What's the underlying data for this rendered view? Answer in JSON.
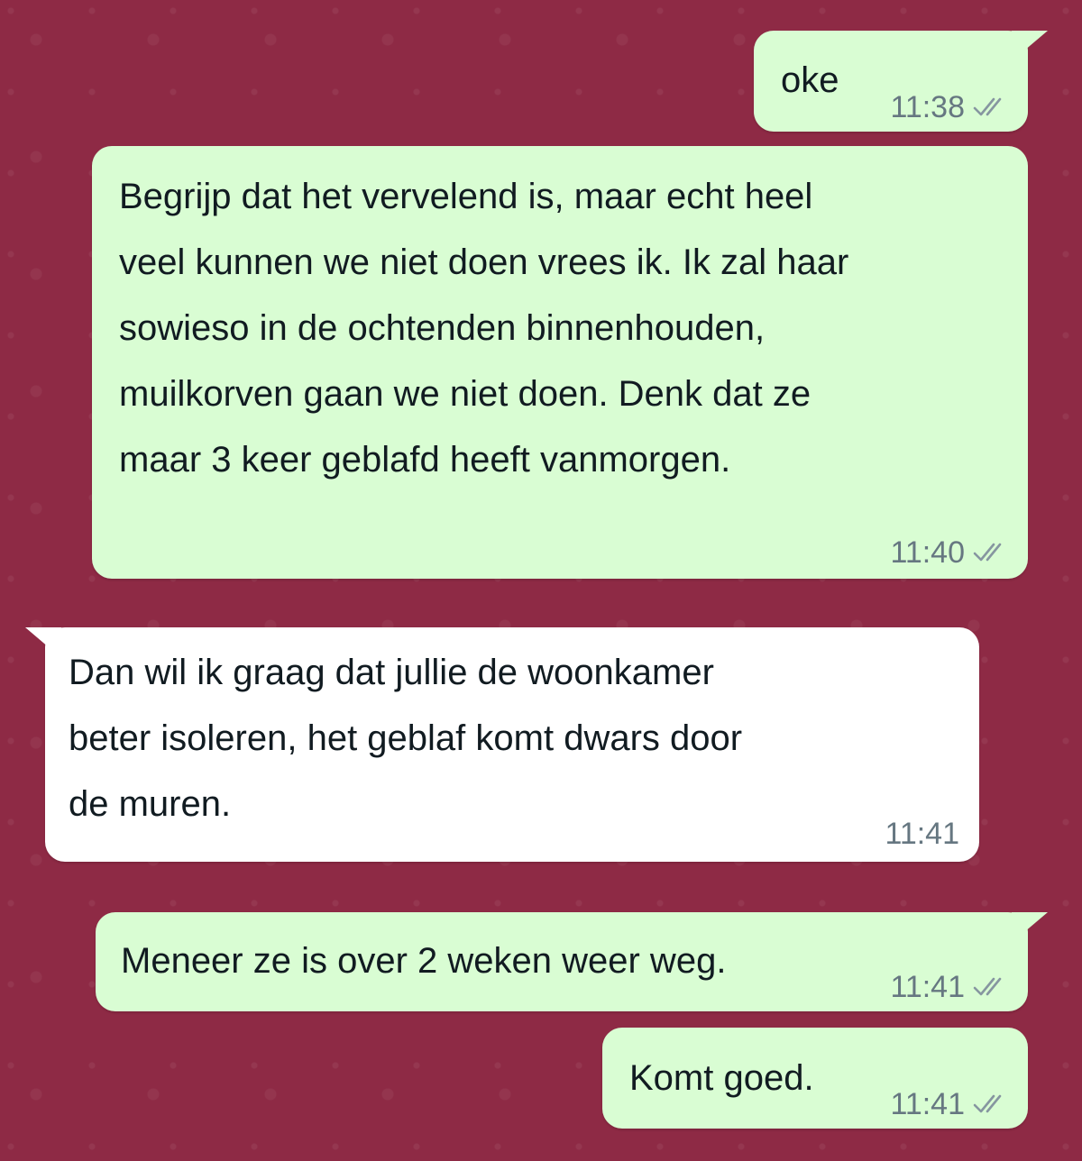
{
  "chat": {
    "messages": [
      {
        "direction": "out",
        "text": "oke",
        "time": "11:38",
        "status": "double-check-icon"
      },
      {
        "direction": "out",
        "text": "Begrijp dat het vervelend is, maar echt heel\nveel kunnen we niet doen vrees ik. Ik zal haar\nsowieso in de ochtenden binnenhouden,\nmuilkorven gaan we niet doen. Denk dat ze\nmaar 3 keer geblafd heeft vanmorgen.",
        "time": "11:40",
        "status": "double-check-icon"
      },
      {
        "direction": "in",
        "text": "Dan wil ik graag dat jullie de woonkamer\nbeter isoleren, het geblaf komt dwars door\nde muren.",
        "time": "11:41"
      },
      {
        "direction": "out",
        "text": "Meneer ze is over 2 weken weer weg.",
        "time": "11:41",
        "status": "double-check-icon"
      },
      {
        "direction": "out",
        "text": "Komt goed.",
        "time": "11:41",
        "status": "double-check-icon"
      }
    ]
  },
  "colors": {
    "wallpaper": "#8e2a45",
    "outgoing_bubble": "#d9fdd3",
    "incoming_bubble": "#ffffff",
    "meta_text": "#667781"
  }
}
